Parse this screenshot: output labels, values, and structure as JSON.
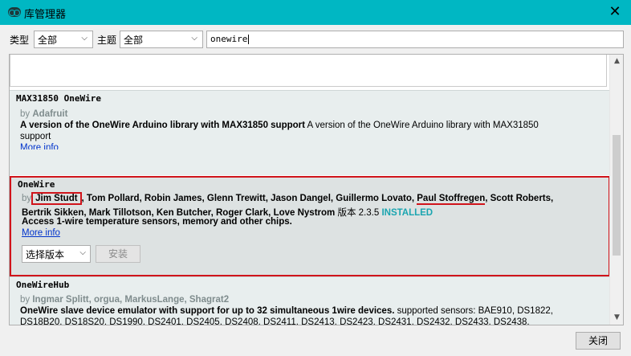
{
  "window": {
    "title": "库管理器",
    "close_glyph": "✕"
  },
  "toolbar": {
    "type_label": "类型",
    "type_value": "全部",
    "topic_label": "主题",
    "topic_value": "全部",
    "search_value": "onewire"
  },
  "libraries": {
    "max31850": {
      "name": "MAX31850 OneWire",
      "by": "by",
      "author": "Adafruit",
      "summary_bold": "A version of the OneWire Arduino library with MAX31850 support",
      "summary_rest": " A version of the OneWire Arduino library with MAX31850",
      "summary_cont": "support",
      "more_info": "More info"
    },
    "onewire": {
      "name": "OneWire",
      "by": "by",
      "author_highlight": "Jim Studt",
      "authors_mid": ", Tom Pollard, Robin James, Glenn Trewitt, Jason Dangel, Guillermo Lovato, ",
      "author_underlined": "Paul Stoffregen",
      "authors_end": ", Scott Roberts,",
      "authors_line2": "Bertrik Sikken, Mark Tillotson, Ken Butcher, Roger Clark, Love Nystrom",
      "version_label": " 版本 2.3.5 ",
      "installed": "INSTALLED",
      "description": "Access 1-wire temperature sensors, memory and other chips.",
      "more_info": "More info",
      "version_select": "选择版本",
      "install_button": "安装"
    },
    "onewirehub": {
      "name": "OneWireHub",
      "by": "by",
      "authors": "Ingmar Splitt, orgua, MarkusLange, Shagrat2",
      "summary_bold": "OneWire slave device emulator with support for up to 32 simultaneous 1wire devices.",
      "summary_rest": " supported sensors: BAE910, DS1822,",
      "summary_line2": "DS18B20, DS18S20, DS1990, DS2401, DS2405, DS2408, DS2411, DS2413, DS2423, DS2431, DS2432, DS2433, DS2438,"
    }
  },
  "footer": {
    "close_button": "关闭"
  },
  "icons": {
    "app": "arduino-logo-icon",
    "scroll_up": "▲",
    "scroll_down": "▼",
    "dropdown": "⌵"
  }
}
